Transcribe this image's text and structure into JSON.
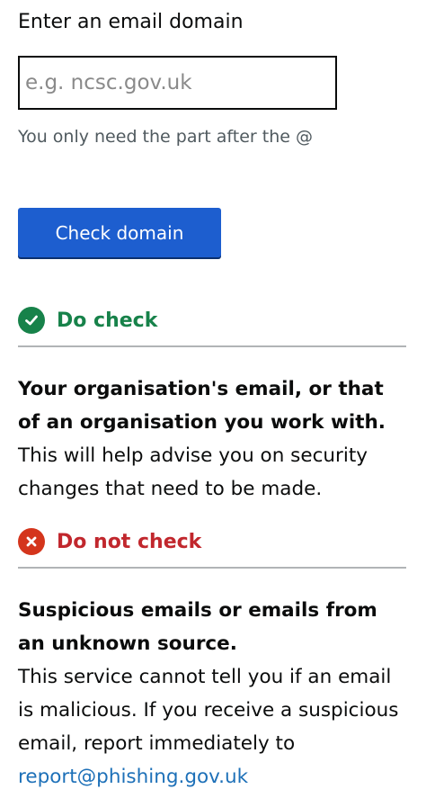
{
  "form": {
    "label": "Enter an email domain",
    "input_placeholder": "e.g. ncsc.gov.uk",
    "input_value": "",
    "hint": "You only need the part after the @",
    "button_label": "Check domain"
  },
  "do_check": {
    "heading": "Do check",
    "lead": "Your organisation's email, or that of an organisation you work with.",
    "body": "This will help advise you on security changes that need to be made."
  },
  "do_not_check": {
    "heading": "Do not check",
    "lead": "Suspicious emails or emails from an unknown source.",
    "body_prefix": "This service cannot tell you if an email is malicious. If you receive a suspicious email, report immediately to ",
    "link_text": "report@phishing.gov.uk"
  },
  "colors": {
    "button": "#1d5ecf",
    "success": "#17824a",
    "error": "#c1272d",
    "link": "#1d70b8",
    "hint": "#505a5f"
  }
}
